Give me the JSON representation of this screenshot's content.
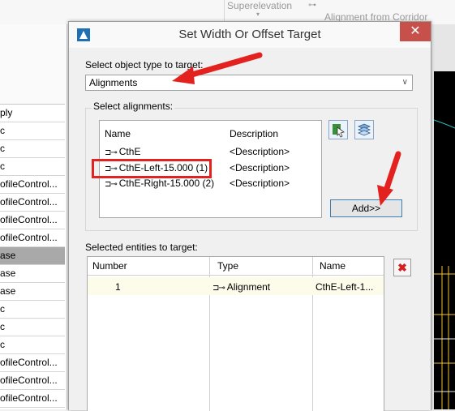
{
  "background": {
    "ribbon_items": [
      "Superelevation",
      "Alignment from Corridor"
    ],
    "left_panel_rows": [
      "ply",
      "c",
      "c",
      "c",
      "ofileControl...",
      "ofileControl...",
      "ofileControl...",
      "ofileControl...",
      "ase",
      "ase",
      "ase",
      "c",
      "c",
      "c",
      "ofileControl...",
      "ofileControl...",
      "ofileControl..."
    ],
    "selected_left_row": 8
  },
  "dialog": {
    "title": "Set Width Or Offset Target",
    "close_glyph": "✕",
    "object_type_label": "Select object type to target:",
    "object_type_value": "Alignments",
    "select_alignments_label": "Select alignments:",
    "alignments_headers": {
      "name": "Name",
      "description": "Description"
    },
    "alignments": [
      {
        "name": "CthE",
        "description": "<Description>"
      },
      {
        "name": "CthE-Left-15.000 (1)",
        "description": "<Description>"
      },
      {
        "name": "CthE-Right-15.000 (2)",
        "description": "<Description>"
      }
    ],
    "add_button": "Add>>",
    "selected_entities_label": "Selected entities to target:",
    "entities_headers": {
      "number": "Number",
      "type": "Type",
      "name": "Name"
    },
    "entities": [
      {
        "number": "1",
        "type": "Alignment",
        "name": "CthE-Left-1..."
      }
    ],
    "delete_glyph": "✖"
  },
  "colors": {
    "annotation_red": "#e3211e",
    "close_button": "#c7504a",
    "cad_background": "#000000"
  }
}
